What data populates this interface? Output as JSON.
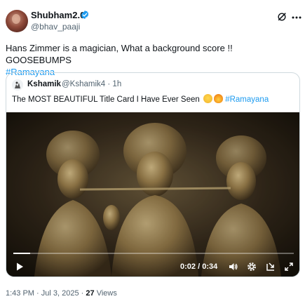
{
  "tweet": {
    "display_name": "Shubham2.0",
    "handle": "@bhav_paaji",
    "text": "Hans Zimmer is a magician, What a background score !! GOOSEBUMPS",
    "hashtag": "#Ramayana",
    "time": "1:43 PM",
    "date": "Jul 3, 2025",
    "separator": "·",
    "views_count": "27",
    "views_label": "Views"
  },
  "quote": {
    "display_name": "Kshamik",
    "handle": "@Kshamik4",
    "separator": "·",
    "age": "1h",
    "text": "The MOST BEAUTIFUL Title Card I Have Ever Seen",
    "hashtag": "#Ramayana",
    "emojis": [
      "crying-face",
      "fire"
    ],
    "video": {
      "elapsed": "0:02",
      "time_separator": " / ",
      "duration": "0:34",
      "progress": 0.06,
      "icons": [
        "play-icon",
        "volume-icon",
        "settings-icon",
        "pip-icon",
        "fullscreen-icon"
      ]
    }
  },
  "colors": {
    "accent": "#1d9bf0",
    "text": "#0f1419",
    "muted": "#536471",
    "border": "#cfd9de"
  }
}
